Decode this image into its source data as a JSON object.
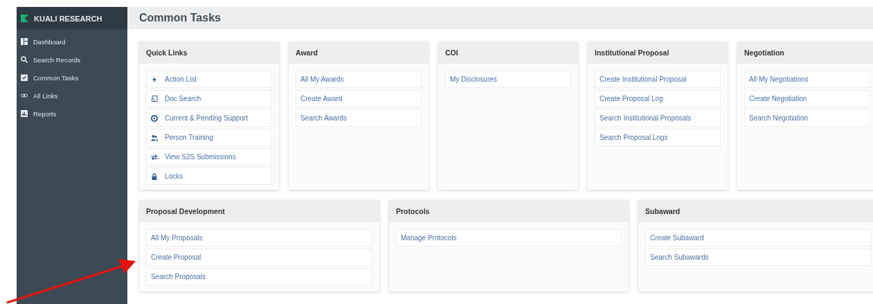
{
  "sidebar": {
    "brand": "KUALI RESEARCH",
    "items": [
      {
        "label": "Dashboard",
        "kind": "dashboard"
      },
      {
        "label": "Search Records",
        "kind": "search"
      },
      {
        "label": "Common Tasks",
        "kind": "tasks"
      },
      {
        "label": "All Links",
        "kind": "links"
      },
      {
        "label": "Reports",
        "kind": "reports"
      }
    ]
  },
  "page": {
    "title": "Common Tasks"
  },
  "rows": [
    {
      "cards": [
        {
          "title": "Quick Links",
          "links": [
            {
              "label": "Action List",
              "kind": "bolt"
            },
            {
              "label": "Doc Search",
              "kind": "doc"
            },
            {
              "label": "Current & Pending Support",
              "kind": "lifebuoy"
            },
            {
              "label": "Person Training",
              "kind": "people"
            },
            {
              "label": "View S2S Submissions",
              "kind": "swap"
            },
            {
              "label": "Locks",
              "kind": "lock"
            }
          ]
        },
        {
          "title": "Award",
          "links": [
            {
              "label": "All My Awards"
            },
            {
              "label": "Create Award"
            },
            {
              "label": "Search Awards"
            }
          ]
        },
        {
          "title": "COI",
          "links": [
            {
              "label": "My Disclosures"
            }
          ]
        },
        {
          "title": "Institutional Proposal",
          "links": [
            {
              "label": "Create Institutional Proposal"
            },
            {
              "label": "Create Proposal Log"
            },
            {
              "label": "Search Institutional Proposals"
            },
            {
              "label": "Search Proposal Logs"
            }
          ]
        },
        {
          "title": "Negotiation",
          "links": [
            {
              "label": "All My Negotiations"
            },
            {
              "label": "Create Negotiation"
            },
            {
              "label": "Search Negotiation"
            }
          ]
        }
      ]
    },
    {
      "cards": [
        {
          "title": "Proposal Development",
          "links": [
            {
              "label": "All My Proposals"
            },
            {
              "label": "Create Proposal"
            },
            {
              "label": "Search Proposals"
            }
          ]
        },
        {
          "title": "Protocols",
          "links": [
            {
              "label": "Manage Protocols"
            }
          ]
        },
        {
          "title": "Subaward",
          "links": [
            {
              "label": "Create Subaward"
            },
            {
              "label": "Search Subawards"
            }
          ]
        }
      ]
    }
  ]
}
